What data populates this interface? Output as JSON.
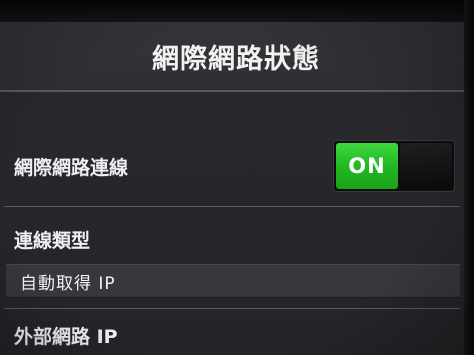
{
  "header": {
    "title": "網際網路狀態"
  },
  "internet_connection": {
    "label": "網際網路連線",
    "toggle_state_label": "ON",
    "toggle_on": true,
    "accent_color": "#22b822"
  },
  "connection_type": {
    "label": "連線類型",
    "value": "自動取得 IP"
  },
  "external_ip": {
    "label": "外部網路 IP"
  }
}
